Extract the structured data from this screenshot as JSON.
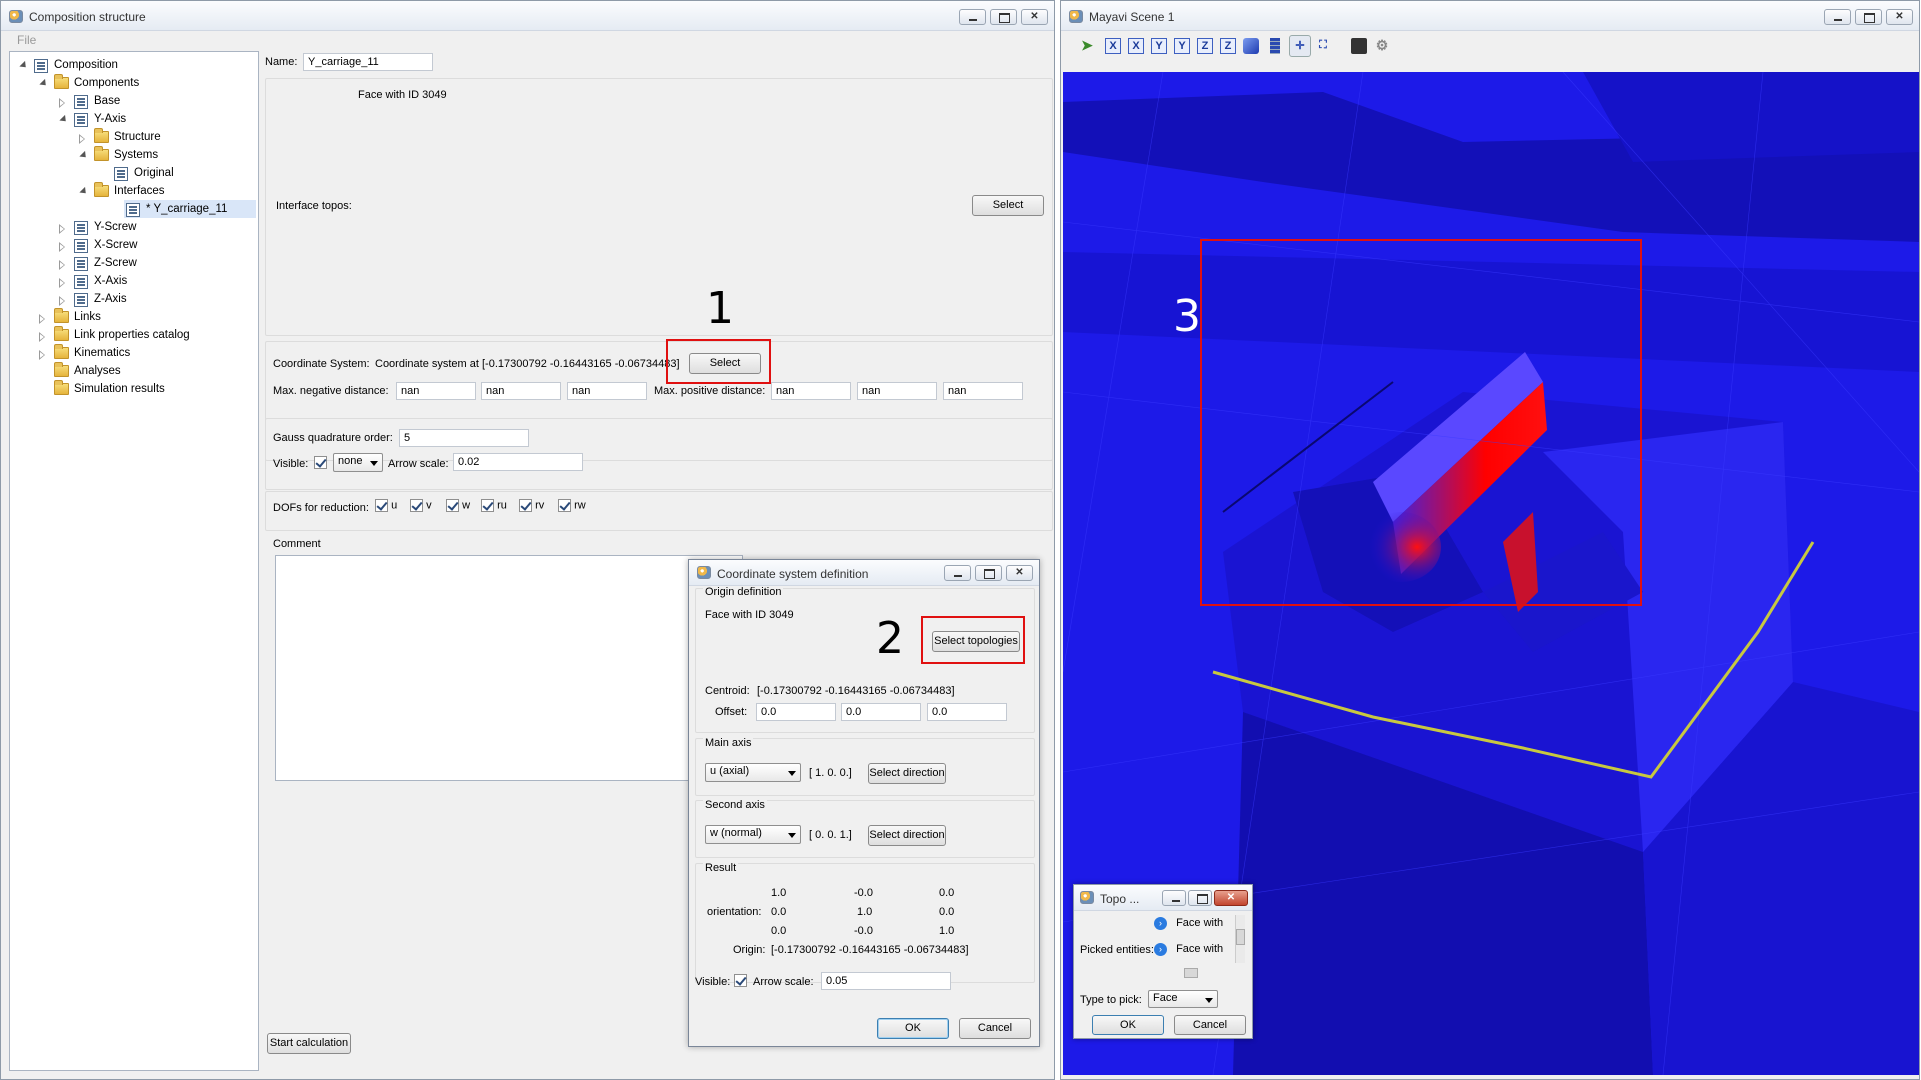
{
  "composition_window": {
    "title": "Composition structure",
    "menu": [
      "File"
    ],
    "tree": [
      {
        "label": "Composition",
        "icon": "composition-icon"
      },
      {
        "label": "Components",
        "icon": "folder-icon"
      },
      {
        "label": "Base",
        "icon": "component-icon"
      },
      {
        "label": "Y-Axis",
        "icon": "component-icon"
      },
      {
        "label": "Structure",
        "icon": "folder-icon"
      },
      {
        "label": "Systems",
        "icon": "folder-icon"
      },
      {
        "label": "Original",
        "icon": "component-icon"
      },
      {
        "label": "Interfaces",
        "icon": "folder-icon"
      },
      {
        "label": "* Y_carriage_11",
        "icon": "component-icon"
      },
      {
        "label": "Y-Screw",
        "icon": "component-icon"
      },
      {
        "label": "X-Screw",
        "icon": "component-icon"
      },
      {
        "label": "Z-Screw",
        "icon": "component-icon"
      },
      {
        "label": "X-Axis",
        "icon": "component-icon"
      },
      {
        "label": "Z-Axis",
        "icon": "component-icon"
      },
      {
        "label": "Links",
        "icon": "folder-icon"
      },
      {
        "label": "Link properties catalog",
        "icon": "folder-icon"
      },
      {
        "label": "Kinematics",
        "icon": "folder-icon"
      },
      {
        "label": "Analyses",
        "icon": "folder-icon"
      },
      {
        "label": "Simulation results",
        "icon": "folder-icon"
      }
    ],
    "form": {
      "name_label": "Name:",
      "name_value": "Y_carriage_11",
      "face_text": "Face with ID 3049",
      "interface_topos_label": "Interface topos:",
      "select_label": "Select",
      "coord_label": "Coordinate System:",
      "coord_value": "Coordinate system at [-0.17300792 -0.16443165 -0.06734483]",
      "coord_select_label": "Select",
      "max_neg_label": "Max. negative distance:",
      "max_neg_values": [
        "nan",
        "nan",
        "nan"
      ],
      "max_pos_label": "Max. positive distance:",
      "max_pos_values": [
        "nan",
        "nan",
        "nan"
      ],
      "gauss_label": "Gauss quadrature order:",
      "gauss_value": "5",
      "visible_label": "Visible:",
      "visible_combo": "none",
      "arrow_scale_label": "Arrow scale:",
      "arrow_scale_value": "0.02",
      "dofs_label": "DOFs for reduction:",
      "dofs": [
        "u",
        "v",
        "w",
        "ru",
        "rv",
        "rw"
      ],
      "comment_label": "Comment",
      "start_calc_label": "Start calculation"
    }
  },
  "coord_dialog": {
    "title": "Coordinate system definition",
    "origin_label": "Origin definition",
    "face_text": "Face with ID 3049",
    "select_topologies_label": "Select topologies",
    "centroid_label": "Centroid:",
    "centroid_value": "[-0.17300792 -0.16443165 -0.06734483]",
    "offset_label": "Offset:",
    "offset_values": [
      "0.0",
      "0.0",
      "0.0"
    ],
    "main_axis_label": "Main axis",
    "main_axis_combo": "u (axial)",
    "main_axis_vec": "[ 1.  0.  0.]",
    "select_direction_label": "Select direction",
    "second_axis_label": "Second axis",
    "second_axis_combo": "w (normal)",
    "second_axis_vec": "[ 0.  0.  1.]",
    "result_label": "Result",
    "orientation_label": "orientation:",
    "matrix": [
      [
        "1.0",
        "-0.0",
        "0.0"
      ],
      [
        "0.0",
        "1.0",
        "0.0"
      ],
      [
        "0.0",
        "-0.0",
        "1.0"
      ]
    ],
    "origin_result_label": "Origin:",
    "origin_result_value": "[-0.17300792 -0.16443165 -0.06734483]",
    "visible_label": "Visible:",
    "arrow_scale_label": "Arrow scale:",
    "arrow_scale_value": "0.05",
    "ok_label": "OK",
    "cancel_label": "Cancel"
  },
  "mayavi_window": {
    "title": "Mayavi Scene 1",
    "toolbar": [
      "pointer-icon",
      "view-x-icon",
      "view-x2-icon",
      "view-y-icon",
      "view-y2-icon",
      "view-z-icon",
      "view-z2-icon",
      "iso-view-icon",
      "parallel-projection-icon",
      "axes-icon",
      "fullscreen-icon",
      "save-icon",
      "settings-icon"
    ],
    "toolbar_labels": [
      "X",
      "X",
      "Y",
      "Y",
      "Z",
      "Z"
    ]
  },
  "topo_dialog": {
    "title": "Topo ...",
    "picked_label": "Picked entities:",
    "items": [
      "Face with",
      "Face with"
    ],
    "type_label": "Type to pick:",
    "type_value": "Face",
    "ok_label": "OK",
    "cancel_label": "Cancel"
  },
  "annotations": [
    "1",
    "2",
    "3"
  ],
  "colors": {
    "scene_blue": "#1010e0",
    "highlight_red": "#ff0000",
    "annotation_red": "#e01010",
    "edge_yellow": "#c8c840"
  }
}
